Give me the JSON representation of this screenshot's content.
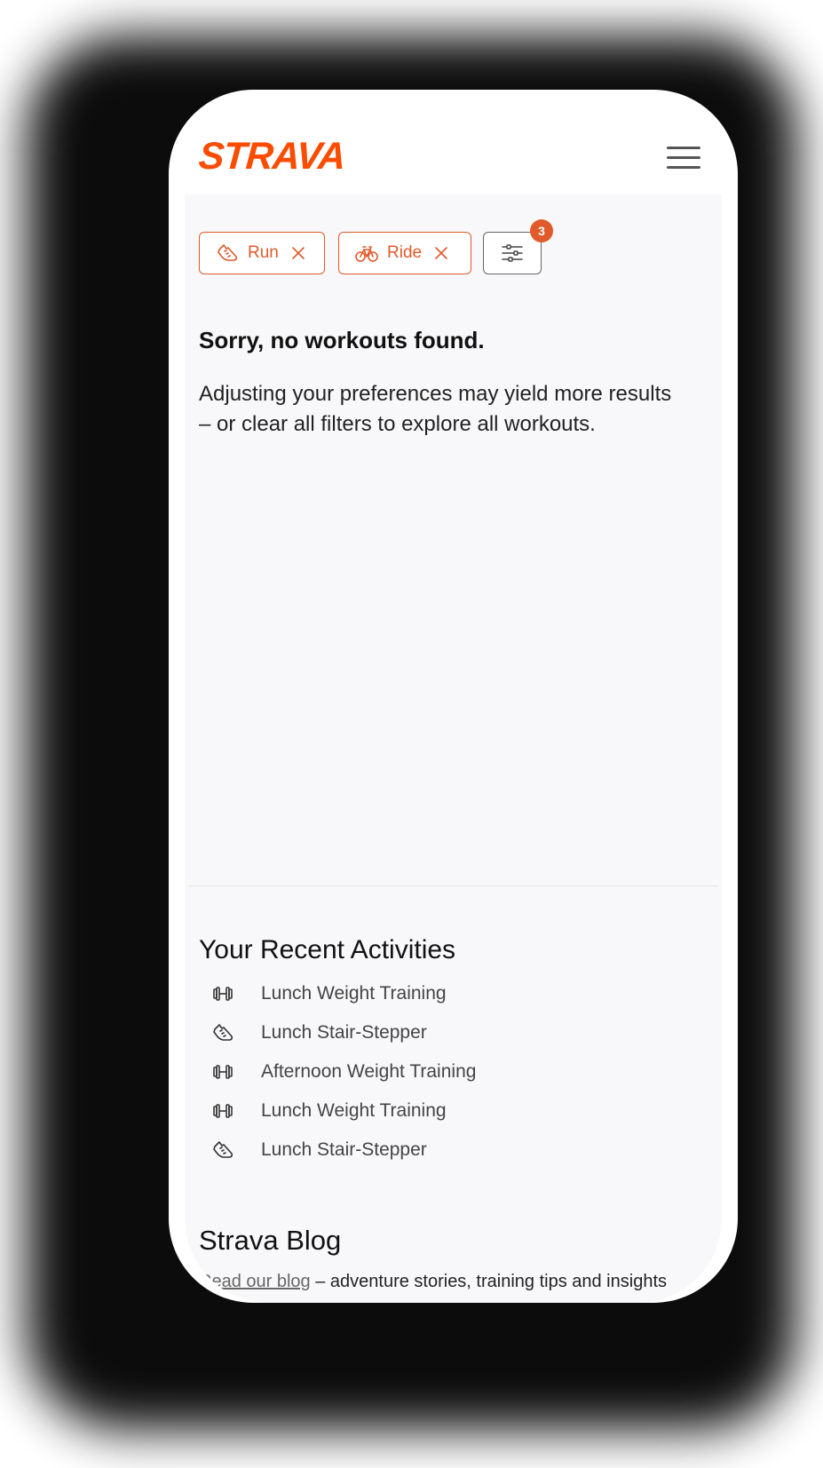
{
  "header": {
    "logo_text": "STRAVA",
    "brand_color": "#fc4c02",
    "menu_icon": "hamburger-menu-icon"
  },
  "filters": {
    "chips": [
      {
        "label": "Run",
        "icon": "running-shoe-icon"
      },
      {
        "label": "Ride",
        "icon": "bicycle-icon"
      }
    ],
    "filter_button_icon": "sliders-icon",
    "badge_count": "3",
    "accent_color": "#e05a2b"
  },
  "empty_state": {
    "title": "Sorry, no workouts found.",
    "body": "Adjusting your preferences may yield more results – or clear all filters to explore all workouts."
  },
  "recent": {
    "title": "Your Recent Activities",
    "items": [
      {
        "label": "Lunch Weight Training",
        "icon": "dumbbell-icon"
      },
      {
        "label": "Lunch Stair-Stepper",
        "icon": "running-shoe-icon"
      },
      {
        "label": "Afternoon Weight Training",
        "icon": "dumbbell-icon"
      },
      {
        "label": "Lunch Weight Training",
        "icon": "dumbbell-icon"
      },
      {
        "label": "Lunch Stair-Stepper",
        "icon": "running-shoe-icon"
      }
    ]
  },
  "blog": {
    "title": "Strava Blog",
    "link_text": "Read our blog",
    "text": " – adventure stories, training tips and insights"
  }
}
